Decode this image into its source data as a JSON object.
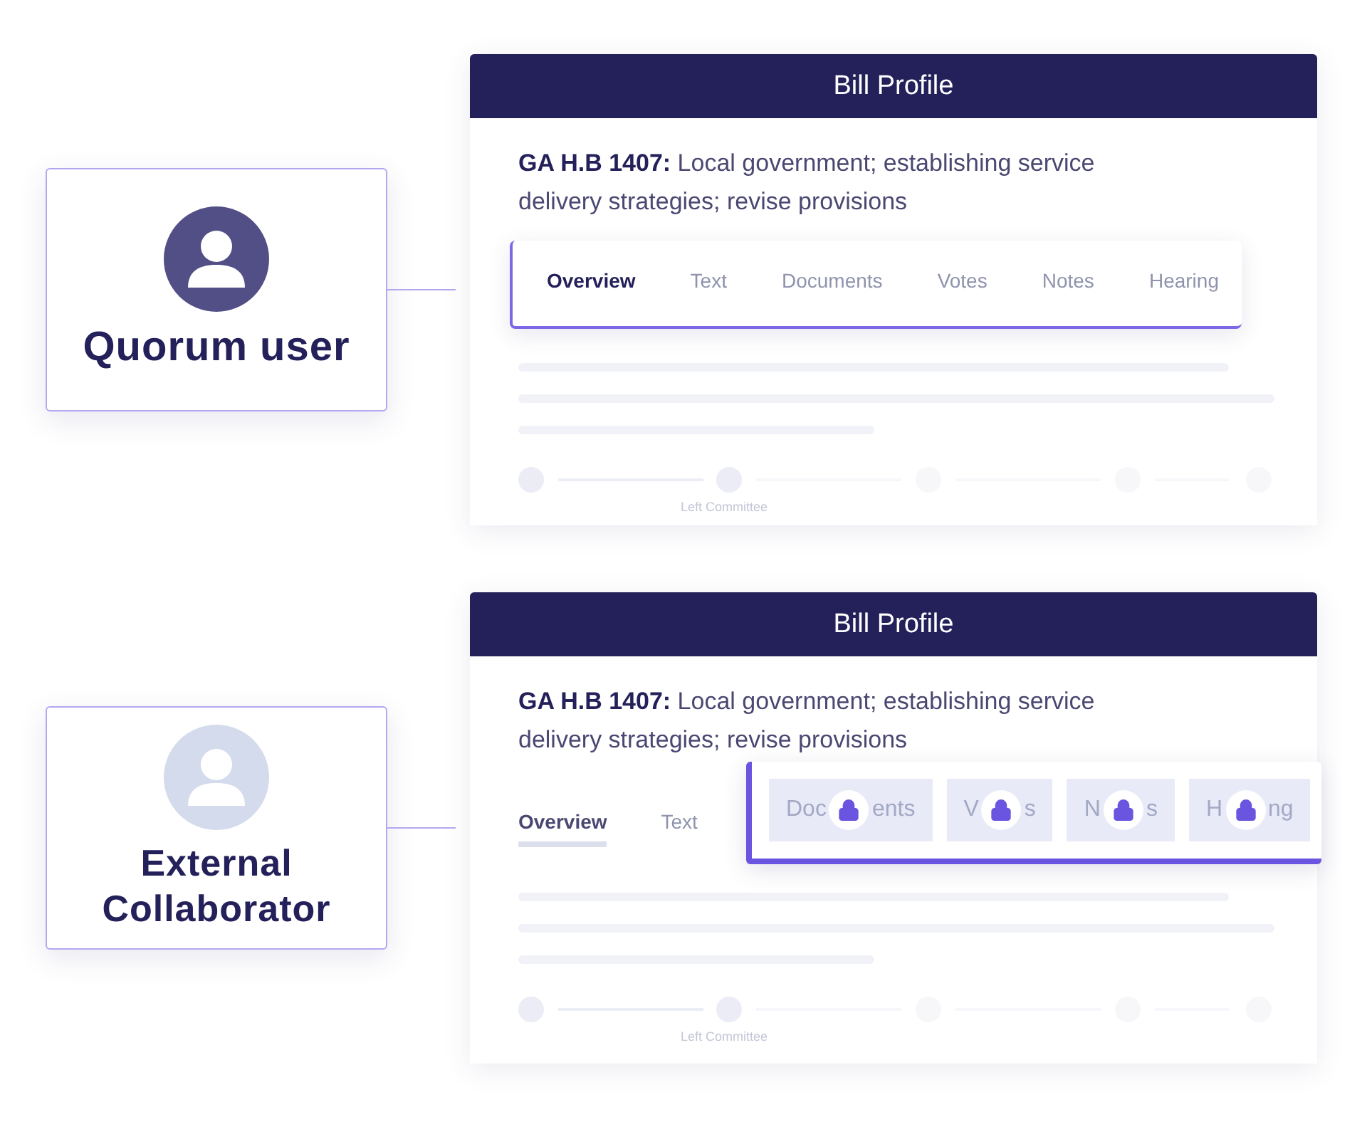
{
  "rows": [
    {
      "kind": "full",
      "user": {
        "name": "Quorum user"
      },
      "bill": {
        "header": "Bill Profile",
        "title": "**GA H.B 1407:** Local government; establishing service delivery strategies; revise provisions",
        "stage_label": "Left Committee",
        "tabs": [
          {
            "label": "Overview",
            "selected": true,
            "locked": false
          },
          {
            "label": "Text",
            "selected": false,
            "locked": false
          },
          {
            "label": "Documents",
            "selected": false,
            "locked": false
          },
          {
            "label": "Votes",
            "selected": false,
            "locked": false
          },
          {
            "label": "Notes",
            "selected": false,
            "locked": false
          },
          {
            "label": "Hearing",
            "selected": false,
            "locked": false
          }
        ]
      }
    },
    {
      "kind": "external",
      "user": {
        "name": "External Collaborator"
      },
      "bill": {
        "header": "Bill Profile",
        "title": "**GA H.B 1407:** Local government; establishing service delivery strategies; revise provisions",
        "stage_label": "Left Committee",
        "tabs": [
          {
            "label": "Overview",
            "selected": true,
            "locked": false
          },
          {
            "label": "Text",
            "selected": false,
            "locked": false
          },
          {
            "label_parts": [
              "Doc",
              "ents"
            ],
            "selected": false,
            "locked": true
          },
          {
            "label_parts": [
              "V",
              "s"
            ],
            "selected": false,
            "locked": true
          },
          {
            "label_parts": [
              "N",
              "s"
            ],
            "selected": false,
            "locked": true
          },
          {
            "label_parts": [
              "H",
              "ng"
            ],
            "selected": false,
            "locked": true
          }
        ]
      }
    }
  ]
}
